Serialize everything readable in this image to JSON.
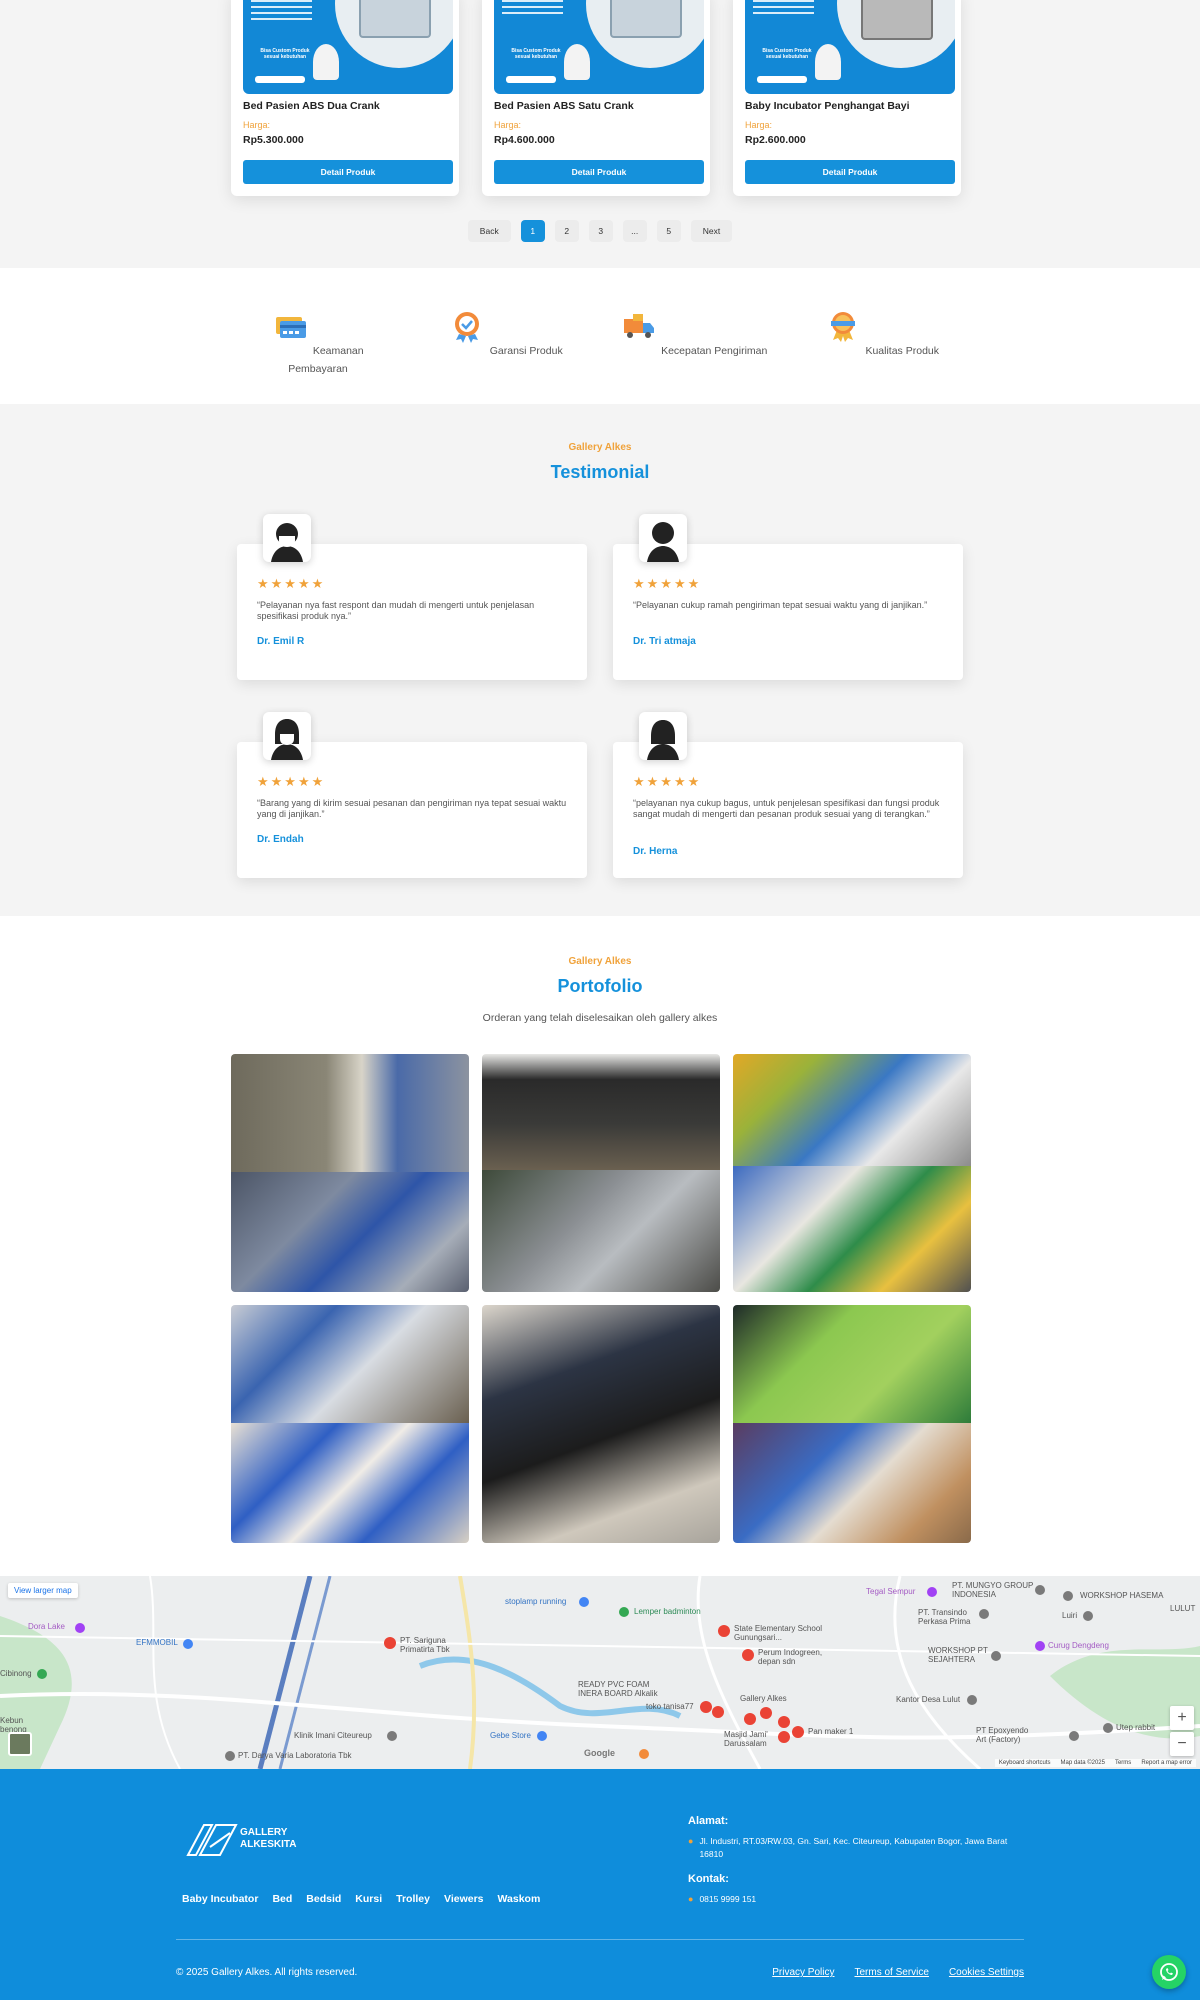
{
  "products": [
    {
      "name": "Bed Pasien ABS Dua Crank",
      "price_label": "Harga:",
      "price": "Rp5.300.000",
      "button": "Detail Produk",
      "banner": "Bisa Custom Produk sesuai kebutuhan",
      "phone": "0815 9999 151"
    },
    {
      "name": "Bed Pasien ABS Satu Crank",
      "price_label": "Harga:",
      "price": "Rp4.600.000",
      "button": "Detail Produk",
      "banner": "Bisa Custom Produk sesuai kebutuhan",
      "phone": "0815 9999 151"
    },
    {
      "name": "Baby Incubator Penghangat Bayi",
      "price_label": "Harga:",
      "price": "Rp2.600.000",
      "button": "Detail Produk",
      "banner": "Bisa Custom Produk sesuai kebutuhan",
      "phone": "0815 9999 151"
    }
  ],
  "pagination": {
    "back": "Back",
    "pages": [
      "1",
      "2",
      "3",
      "...",
      "5"
    ],
    "active": "1",
    "next": "Next"
  },
  "features": [
    {
      "label": "Keamanan Pembayaran",
      "icon": "credit-card-icon"
    },
    {
      "label": "Garansi Produk",
      "icon": "guarantee-medal-icon"
    },
    {
      "label": "Kecepatan Pengiriman",
      "icon": "delivery-truck-icon"
    },
    {
      "label": "Kualitas Produk",
      "icon": "quality-badge-icon"
    }
  ],
  "testimonial": {
    "kicker": "Gallery Alkes",
    "title": "Testimonial",
    "items": [
      {
        "quote": "“Pelayanan nya fast respont dan mudah di mengerti untuk penjelasan spesifikasi produk nya.”",
        "name": "Dr. Emil R",
        "rating": 5
      },
      {
        "quote": "“Pelayanan cukup ramah pengiriman tepat sesuai waktu yang di janjikan.”",
        "name": "Dr. Tri atmaja",
        "rating": 5
      },
      {
        "quote": "“Barang yang di kirim sesuai pesanan dan pengiriman nya tepat sesuai waktu yang di janjikan.”",
        "name": "Dr. Endah",
        "rating": 5
      },
      {
        "quote": "“pelayanan nya cukup bagus, untuk penjelesan spesifikasi dan fungsi produk sangat mudah di mengerti dan pesanan produk sesuai yang di terangkan.”",
        "name": "Dr. Herna",
        "rating": 5
      }
    ]
  },
  "portfolio": {
    "kicker": "Gallery Alkes",
    "title": "Portofolio",
    "subtitle": "Orderan yang telah diselesaikan oleh gallery alkes"
  },
  "map": {
    "view_larger": "View larger map",
    "zoom_in": "+",
    "zoom_out": "−",
    "labels": {
      "dora_lake": "Dora Lake",
      "efmmobil": "EFMMOBIL",
      "pt_sariguna": "PT. Sariguna Primatirta Tbk",
      "stoplamp": "stoplamp running",
      "lemper": "Lemper badminton",
      "state_school": "State Elementary School Gunungsari...",
      "perum": "Perum Indogreen, depan sdn",
      "ready_pvc": "READY PVC FOAM INERA BOARD Alkalik",
      "toko_tanisa": "toko tanisa77",
      "gallery_alkes": "Gallery Alkes",
      "masjid": "Masjid Jami' Darussalam",
      "pan_maker": "Pan maker 1",
      "klinik": "Klinik Imani Citeureup",
      "gebe": "Gebe Store",
      "pt_darya": "PT. Darya Varia Laboratoria Tbk",
      "tegal": "Tegal Sempur",
      "pt_trasindo": "PT. Transindo Perkasa Prima",
      "pt_mungyo": "PT. MUNGYO GROUP INDONESIA",
      "workshop_hasema": "WORKSHOP HASEMA",
      "luiri": "Luiri",
      "curug": "Curug Dengdeng",
      "workshop_pt": "WORKSHOP PT SEJAHTERA",
      "kantor": "Kantor Desa Lulut",
      "pt_epoxy": "PT Epoxyendo Art (Factory)",
      "utep": "Utep rabbit",
      "lulut": "LULUT",
      "google": "Google",
      "ciburang": "Cibinong",
      "kebun": "Kebun benong"
    },
    "footer": [
      "Keyboard shortcuts",
      "Map data ©2025",
      "Terms",
      "Report a map error"
    ]
  },
  "footer": {
    "logo_line1": "GALLERY",
    "logo_line2": "ALKESKITA",
    "nav": [
      "Baby Incubator",
      "Bed",
      "Bedsid",
      "Kursi",
      "Trolley",
      "Viewers",
      "Waskom"
    ],
    "address_title": "Alamat:",
    "address": "Jl. Industri, RT.03/RW.03, Gn. Sari, Kec. Citeureup, Kabupaten Bogor, Jawa Barat 16810",
    "contact_title": "Kontak:",
    "phone": "0815 9999 151",
    "copyright": "© 2025 Gallery Alkes. All rights reserved.",
    "links": [
      "Privacy Policy",
      "Terms of Service",
      "Cookies Settings"
    ]
  },
  "colors": {
    "primary": "#1591db",
    "accent": "#f0a23a",
    "footer_bg": "#0f8ddb",
    "whatsapp": "#25d366"
  }
}
